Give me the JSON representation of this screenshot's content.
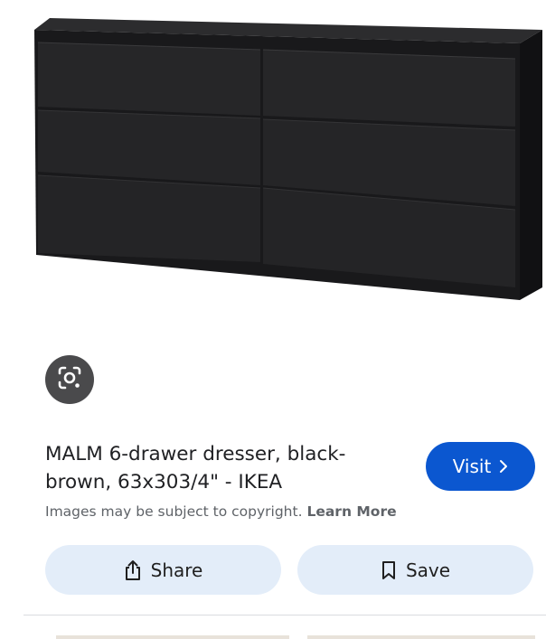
{
  "product_image": {
    "alt": "MALM 6-drawer dresser, black-brown",
    "colors": {
      "body": "#1e1e20",
      "drawer_front": "#262628",
      "shadow": "#0e0e10"
    }
  },
  "lens_button": {
    "icon": "lens-search-icon"
  },
  "result": {
    "title": "MALM 6-drawer dresser, black-brown, 63x303/4\" - IKEA",
    "copyright_text": "Images may be subject to copyright.",
    "learn_more_label": "Learn More"
  },
  "visit_button": {
    "label": "Visit",
    "icon": "chevron-right-icon",
    "color": "#0b57d0"
  },
  "share_button": {
    "label": "Share",
    "icon": "share-icon"
  },
  "save_button": {
    "label": "Save",
    "icon": "bookmark-icon"
  }
}
